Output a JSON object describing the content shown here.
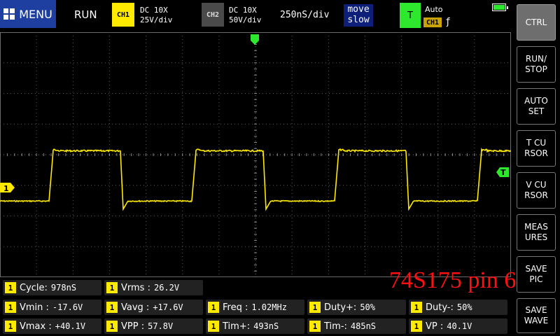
{
  "header": {
    "menu_label": "MENU",
    "run_status": "RUN",
    "ch1": {
      "badge": "CH1",
      "coupling": "DC  10X",
      "scale": "25V/div"
    },
    "ch2": {
      "badge": "CH2",
      "coupling": "DC  10X",
      "scale": "50V/div"
    },
    "timebase": "250nS/div",
    "move": {
      "line1": "move",
      "line2": "slow"
    },
    "trigger": {
      "badge": "T",
      "mode": "Auto",
      "source": "CH1",
      "edge_icon": "rising-edge-icon"
    },
    "battery_level_pct": 100
  },
  "side_menu": [
    {
      "label": "CTRL",
      "active": true
    },
    {
      "label": "RUN/\nSTOP",
      "active": false
    },
    {
      "label": "AUTO\nSET",
      "active": false
    },
    {
      "label": "T CU\nRSOR",
      "active": false
    },
    {
      "label": "V CU\nRSOR",
      "active": false
    },
    {
      "label": "MEAS\nURES",
      "active": false
    },
    {
      "label": "SAVE\nPIC",
      "active": false
    },
    {
      "label": "SAVE\nWAVE",
      "active": false
    }
  ],
  "markers": {
    "channel": "1",
    "trigger": "T"
  },
  "annotation": "74S175 pin 6",
  "measurements": [
    {
      "ch": "1",
      "name": "Cycle:",
      "value": "978nS"
    },
    {
      "ch": "1",
      "name": "Vrms :",
      "value": "26.2V"
    },
    {
      "ch": "1",
      "name": "Vmin :",
      "value": "-17.6V"
    },
    {
      "ch": "1",
      "name": "Vavg :",
      "value": "+17.6V"
    },
    {
      "ch": "1",
      "name": "Freq :",
      "value": "1.02MHz"
    },
    {
      "ch": "1",
      "name": "Duty+:",
      "value": "50%"
    },
    {
      "ch": "1",
      "name": "Duty-:",
      "value": "50%"
    },
    {
      "ch": "1",
      "name": "Vmax :",
      "value": "+40.1V"
    },
    {
      "ch": "1",
      "name": "VPP  :",
      "value": "57.8V"
    },
    {
      "ch": "1",
      "name": "Tim+:",
      "value": "493nS"
    },
    {
      "ch": "1",
      "name": "Tim-:",
      "value": "485nS"
    },
    {
      "ch": "1",
      "name": "VP  :",
      "value": "40.1V"
    }
  ],
  "colors": {
    "trace": "#ffea00",
    "trigger": "#2ee82e",
    "annotation": "#ff1010",
    "menu_active": "#6e6e6e"
  },
  "waveform": {
    "channel": "CH1",
    "screen_divisions": {
      "x": 14,
      "y": 8
    },
    "volts_per_div": 25,
    "ns_per_div": 250,
    "period_ns": 978,
    "duty_pct": 50,
    "high_v": 30,
    "low_v": -11,
    "overshoot_v": 40.1,
    "undershoot_v": -17.6
  }
}
